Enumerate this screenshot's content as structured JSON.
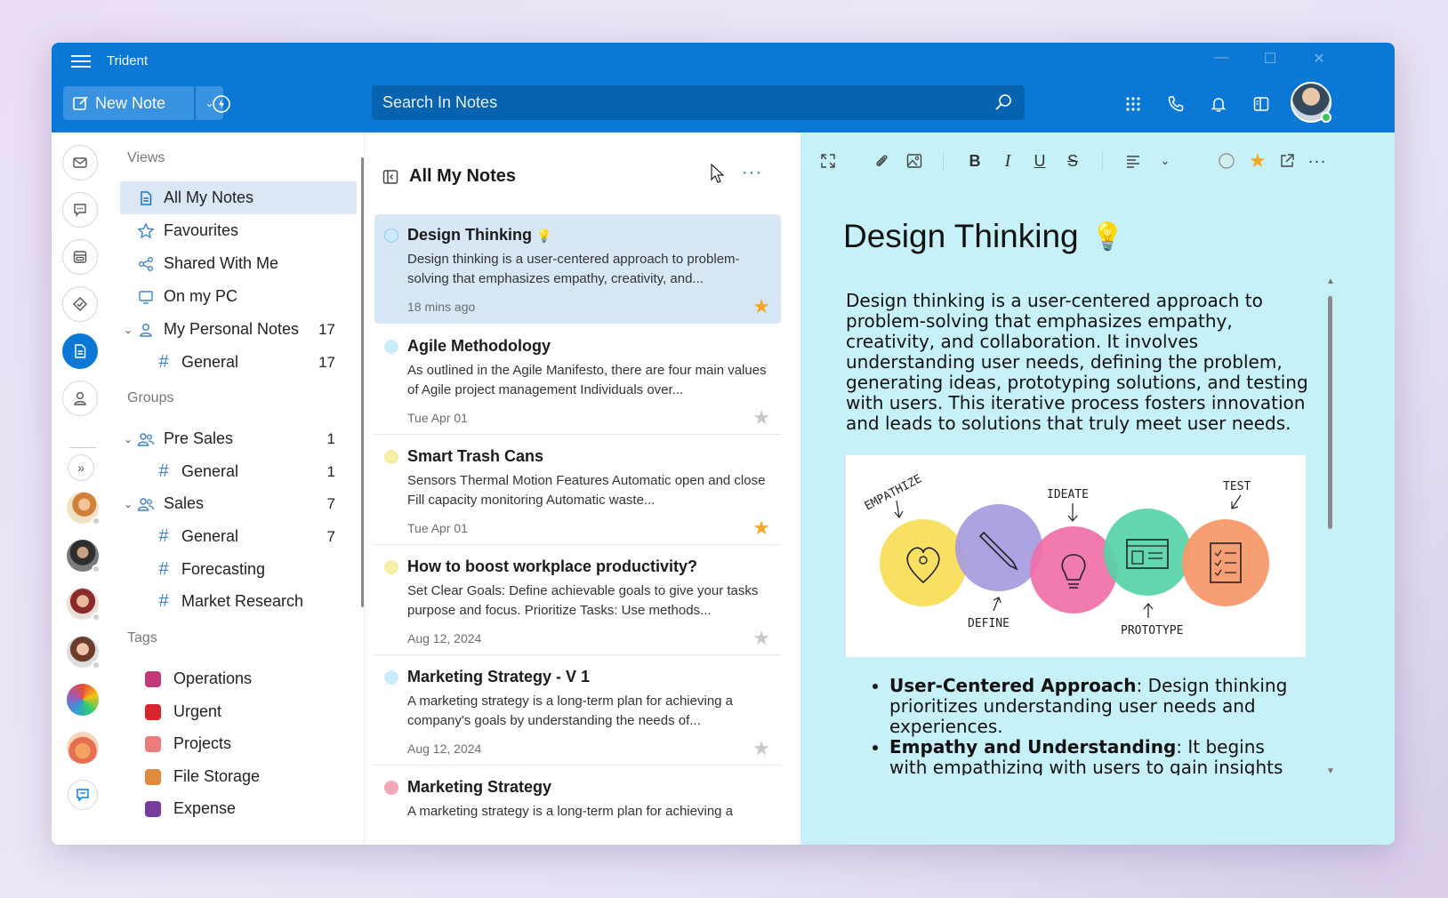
{
  "app": {
    "title": "Trident"
  },
  "window_controls": {
    "minimize": "—",
    "maximize": "☐",
    "close": "✕"
  },
  "toolbar": {
    "new_note_label": "New Note",
    "search_placeholder": "Search In Notes"
  },
  "sidebar": {
    "views_label": "Views",
    "views": [
      {
        "label": "All My Notes",
        "icon": "notes-icon",
        "selected": true
      },
      {
        "label": "Favourites",
        "icon": "star-icon"
      },
      {
        "label": "Shared With Me",
        "icon": "share-icon"
      },
      {
        "label": "On my PC",
        "icon": "monitor-icon"
      },
      {
        "label": "My Personal Notes",
        "icon": "person-icon",
        "count": "17"
      },
      {
        "label": "General",
        "icon": "hash-icon",
        "count": "17"
      }
    ],
    "groups_label": "Groups",
    "groups": [
      {
        "label": "Pre Sales",
        "count": "1"
      },
      {
        "label": "General",
        "count": "1"
      },
      {
        "label": "Sales",
        "count": "7"
      },
      {
        "label": "General",
        "count": "7"
      },
      {
        "label": "Forecasting",
        "count": ""
      },
      {
        "label": "Market Research",
        "count": ""
      }
    ],
    "tags_label": "Tags",
    "tags": [
      {
        "label": "Operations",
        "color": "#c2397a"
      },
      {
        "label": "Urgent",
        "color": "#d8262f"
      },
      {
        "label": "Projects",
        "color": "#ea7c7c"
      },
      {
        "label": "File Storage",
        "color": "#e08a3c"
      },
      {
        "label": "Expense",
        "color": "#7a3c9c"
      }
    ]
  },
  "list": {
    "title": "All My Notes",
    "more": "···",
    "notes": [
      {
        "title": "Design Thinking",
        "emoji": "💡",
        "body": "Design thinking is a user-centered approach to problem-solving that emphasizes empathy, creativity, and...",
        "time": "18 mins ago",
        "starred": true,
        "dot": "#c9ecf8"
      },
      {
        "title": "Agile Methodology",
        "body": "As outlined in the Agile Manifesto, there are four main values of Agile project management Individuals over...",
        "time": "Tue Apr 01",
        "starred": false,
        "dot": "#c9ecf8"
      },
      {
        "title": "Smart Trash Cans",
        "body": "Sensors Thermal Motion Features Automatic open and close Fill capacity monitoring Automatic waste...",
        "time": "Tue Apr 01",
        "starred": true,
        "dot": "#f6efa6"
      },
      {
        "title": "How to boost workplace productivity?",
        "body": "Set Clear Goals: Define achievable goals to give your tasks purpose and focus. Prioritize Tasks: Use methods...",
        "time": "Aug 12, 2024",
        "starred": false,
        "dot": "#f6efa6"
      },
      {
        "title": "Marketing Strategy - V 1",
        "body": "A marketing strategy is a long-term plan for achieving a company's goals by understanding the needs of...",
        "time": "Aug 12, 2024",
        "starred": false,
        "dot": "#c9ecf8"
      },
      {
        "title": "Marketing Strategy",
        "body": "A marketing strategy is a long-term plan for achieving a",
        "time": "",
        "starred": false,
        "dot": "#f3a7b4"
      }
    ]
  },
  "editor": {
    "title": "Design Thinking",
    "title_emoji": "💡",
    "paragraph": "Design thinking is a user-centered approach to problem-solving that emphasizes empathy, creativity, and collaboration. It involves understanding user needs, defining the problem, generating ideas, prototyping solutions, and testing with users. This iterative process fosters innovation and leads to solutions that truly meet user needs.",
    "image_labels": {
      "empathize": "EMPATHIZE",
      "define": "DEFINE",
      "ideate": "IDEATE",
      "prototype": "PROTOTYPE",
      "test": "TEST"
    },
    "bullets": [
      {
        "bold": "User-Centered Approach",
        "text": ": Design thinking prioritizes understanding user needs and experiences."
      },
      {
        "bold": "Empathy and Understanding",
        "text": ": It begins with empathizing with users to gain insights into"
      }
    ]
  },
  "colors": {
    "accent": "#0a78d4",
    "editor_bg": "#c7f1f8",
    "star_on": "#f5a623",
    "star_off": "#c8c8c8"
  }
}
